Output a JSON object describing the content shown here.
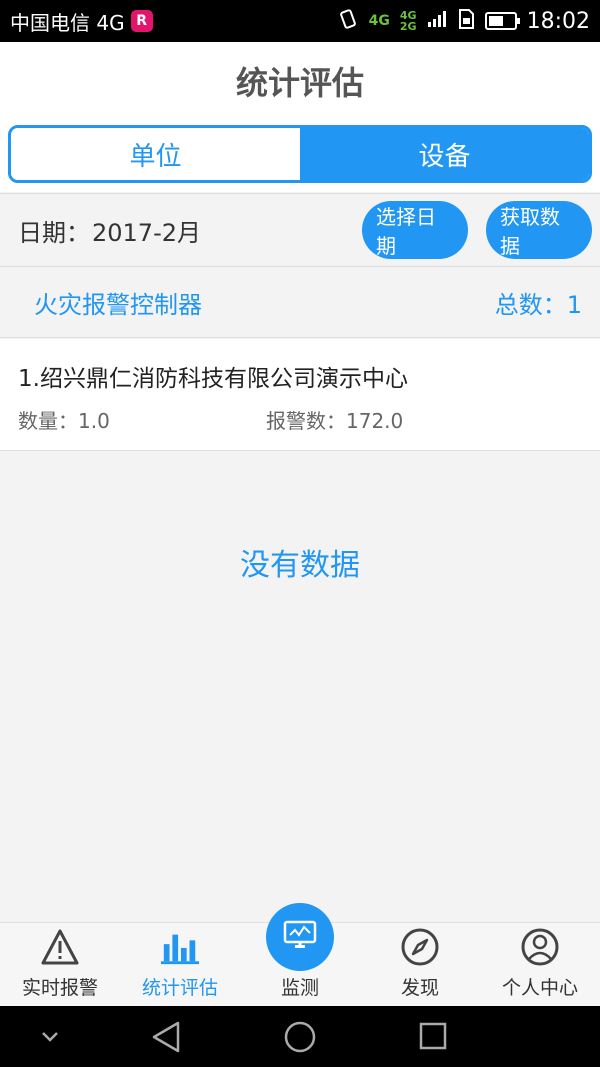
{
  "status": {
    "carrier": "中国电信 4G",
    "carrier_badge": "R",
    "net1": "4G",
    "net2": "4G",
    "net3": "2G",
    "time": "18:02",
    "battery_level": 0.6
  },
  "header": {
    "title": "统计评估"
  },
  "segments": [
    {
      "label": "单位",
      "active": false
    },
    {
      "label": "设备",
      "active": true
    }
  ],
  "date_row": {
    "label": "日期：",
    "value": "2017-2月",
    "select_button": "选择日期",
    "fetch_button": "获取数据"
  },
  "category": {
    "name": "火灾报警控制器",
    "total_label": "总数：",
    "total_value": "1"
  },
  "items": [
    {
      "title": "1.绍兴鼎仁消防科技有限公司演示中心",
      "qty_label": "数量：",
      "qty_value": "1.0",
      "alarm_label": "报警数：",
      "alarm_value": "172.0"
    }
  ],
  "empty_text": "没有数据",
  "bottom_nav": [
    {
      "label": "实时报警",
      "icon": "warning-icon"
    },
    {
      "label": "统计评估",
      "icon": "bar-chart-icon",
      "active": true
    },
    {
      "label": "监测",
      "icon": "monitor-icon"
    },
    {
      "label": "发现",
      "icon": "compass-icon"
    },
    {
      "label": "个人中心",
      "icon": "user-icon"
    }
  ],
  "colors": {
    "accent": "#2196f3",
    "title_text": "#555555"
  }
}
